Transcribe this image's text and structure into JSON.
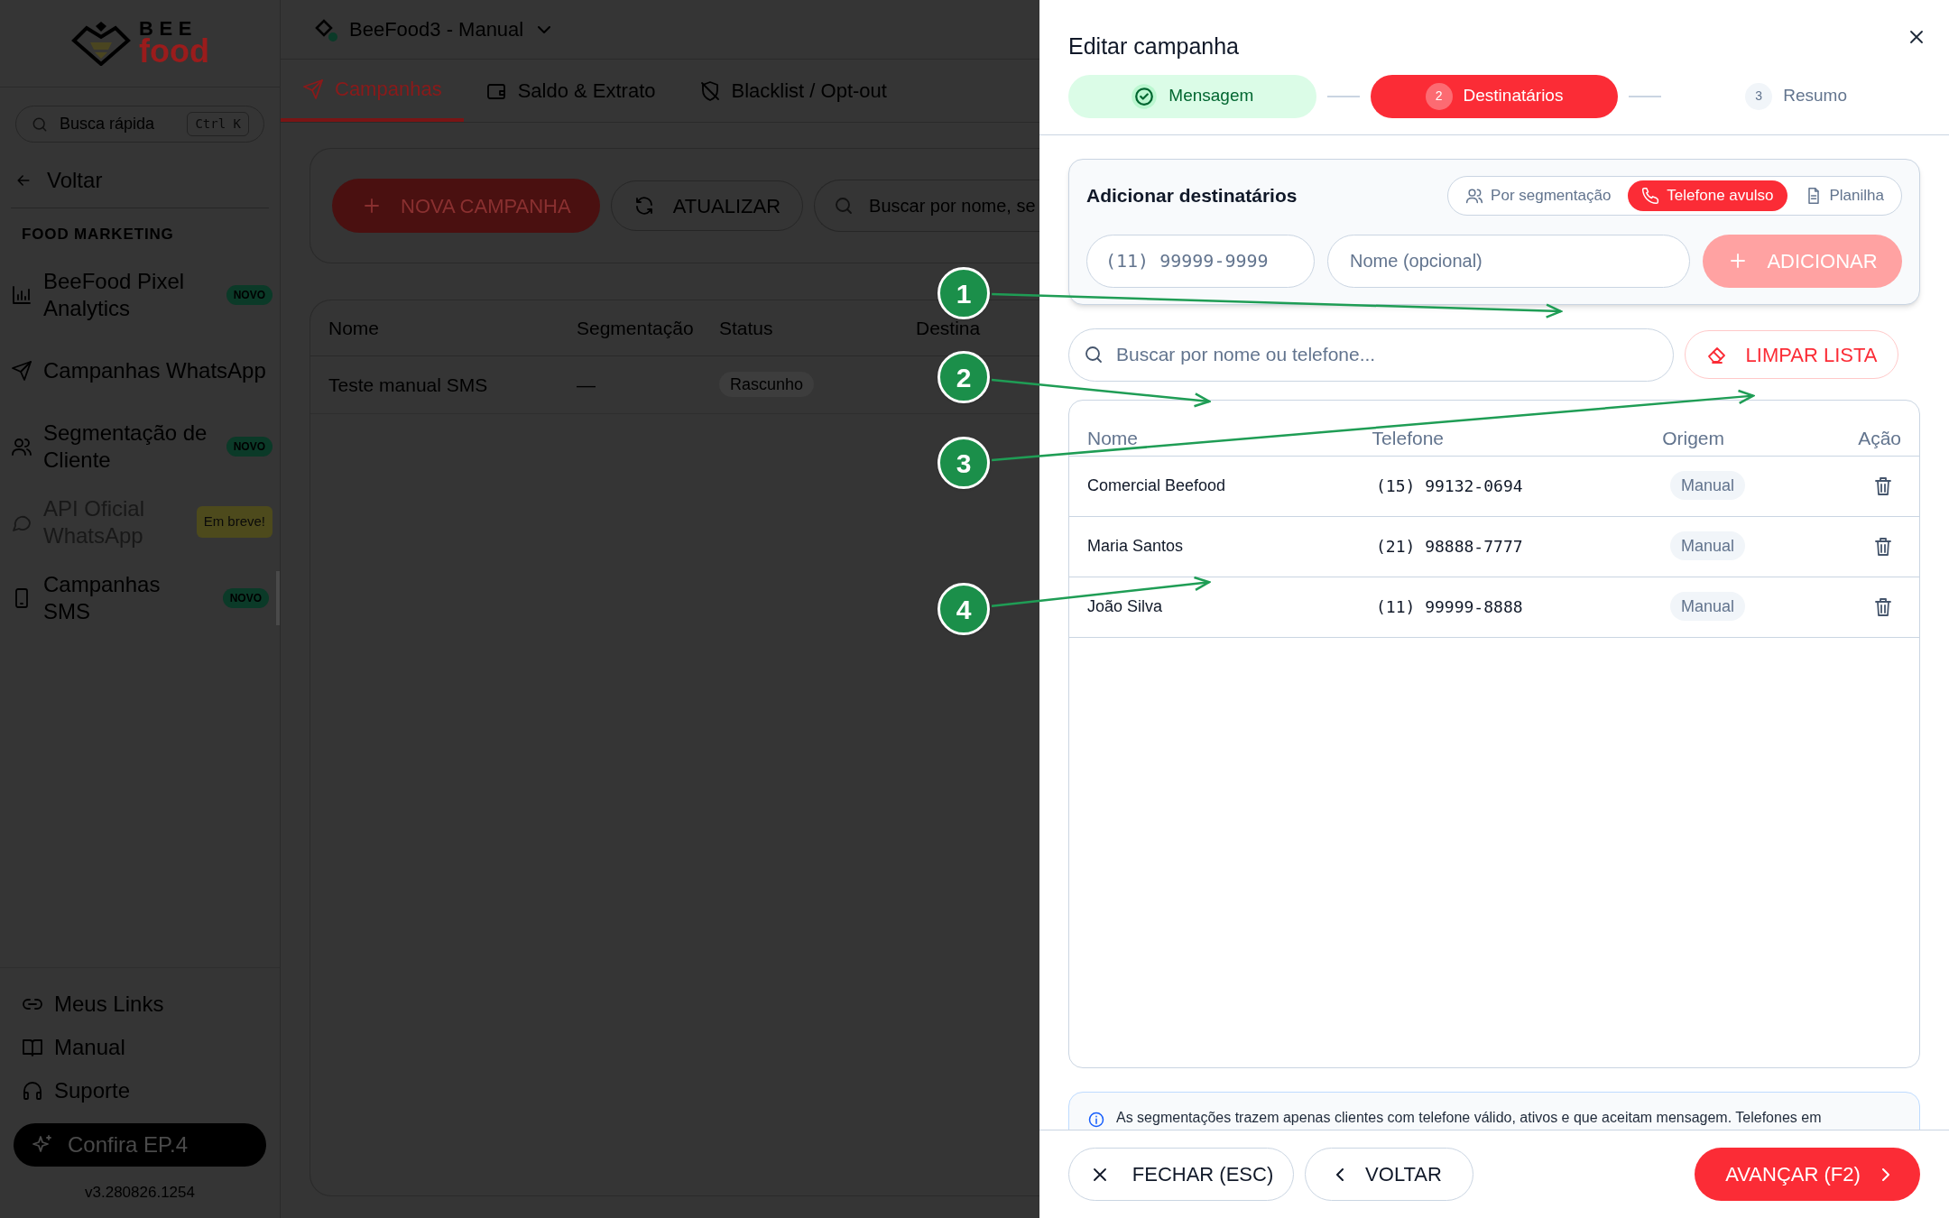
{
  "sidebar": {
    "logo": {
      "line1": "BEE",
      "line2": "food"
    },
    "search": {
      "placeholder": "Busca rápida",
      "shortcut": "Ctrl K"
    },
    "back": "Voltar",
    "section": "FOOD MARKETING",
    "items": [
      {
        "label": "BeeFood Pixel Analytics",
        "badge": "NOVO",
        "disabled": false,
        "selected": false
      },
      {
        "label": "Campanhas WhatsApp",
        "disabled": false,
        "selected": false
      },
      {
        "label": "Segmentação de Cliente",
        "badge": "NOVO",
        "disabled": false,
        "selected": false
      },
      {
        "label": "API Oficial WhatsApp",
        "badge": "Em breve!",
        "disabled": true,
        "selected": false
      },
      {
        "label": "Campanhas SMS",
        "badge": "NOVO",
        "disabled": false,
        "selected": true
      }
    ],
    "footer_links": [
      "Meus Links",
      "Manual",
      "Suporte"
    ],
    "promo": "Confira EP.4",
    "version": "v3.280826.1254"
  },
  "topbar": {
    "title": "BeeFood3 - Manual"
  },
  "tabs": [
    {
      "label": "Campanhas",
      "selected": true
    },
    {
      "label": "Saldo & Extrato",
      "selected": false
    },
    {
      "label": "Blacklist / Opt-out",
      "selected": false
    }
  ],
  "toolbar": {
    "new_button": "NOVA CAMPANHA",
    "refresh_button": "ATUALIZAR",
    "search_placeholder": "Buscar por nome, se"
  },
  "campaigns_table": {
    "columns": [
      "Nome",
      "Segmentação",
      "Status",
      "Destina"
    ],
    "rows": [
      {
        "cells": [
          "Teste manual SMS",
          "—",
          "Rascunho"
        ]
      }
    ]
  },
  "modal": {
    "title": "Editar campanha",
    "steps": [
      {
        "label": "Mensagem",
        "done": true,
        "selected": false
      },
      {
        "number": "2",
        "label": "Destinatários",
        "done": false,
        "selected": true
      },
      {
        "number": "3",
        "label": "Resumo",
        "done": false,
        "selected": false
      }
    ],
    "add_card": {
      "title": "Adicionar destinatários",
      "modes": [
        {
          "label": "Por segmentação",
          "selected": false
        },
        {
          "label": "Telefone avulso",
          "selected": true
        },
        {
          "label": "Planilha",
          "selected": false
        }
      ],
      "phone_placeholder": "(11) 99999-9999",
      "name_placeholder": "Nome (opcional)",
      "add_button": {
        "label": "ADICIONAR",
        "disabled": true
      }
    },
    "list_search_placeholder": "Buscar por nome ou telefone...",
    "clear_button": "LIMPAR LISTA",
    "table": {
      "columns": [
        "Nome",
        "Telefone",
        "Origem",
        "Ação"
      ],
      "rows": [
        {
          "name": "Comercial Beefood",
          "phone": "(15) 99132-0694",
          "origin": "Manual"
        },
        {
          "name": "Maria Santos",
          "phone": "(21) 98888-7777",
          "origin": "Manual"
        },
        {
          "name": "João Silva",
          "phone": "(11) 99999-8888",
          "origin": "Manual"
        }
      ]
    },
    "info": "As segmentações trazem apenas clientes com telefone válido, ativos e que aceitam mensagem. Telefones em",
    "footer": {
      "close_button": "FECHAR (ESC)",
      "back_button": "VOLTAR",
      "next_button": "AVANÇAR (F2)"
    }
  },
  "callouts": [
    "1",
    "2",
    "3",
    "4"
  ]
}
